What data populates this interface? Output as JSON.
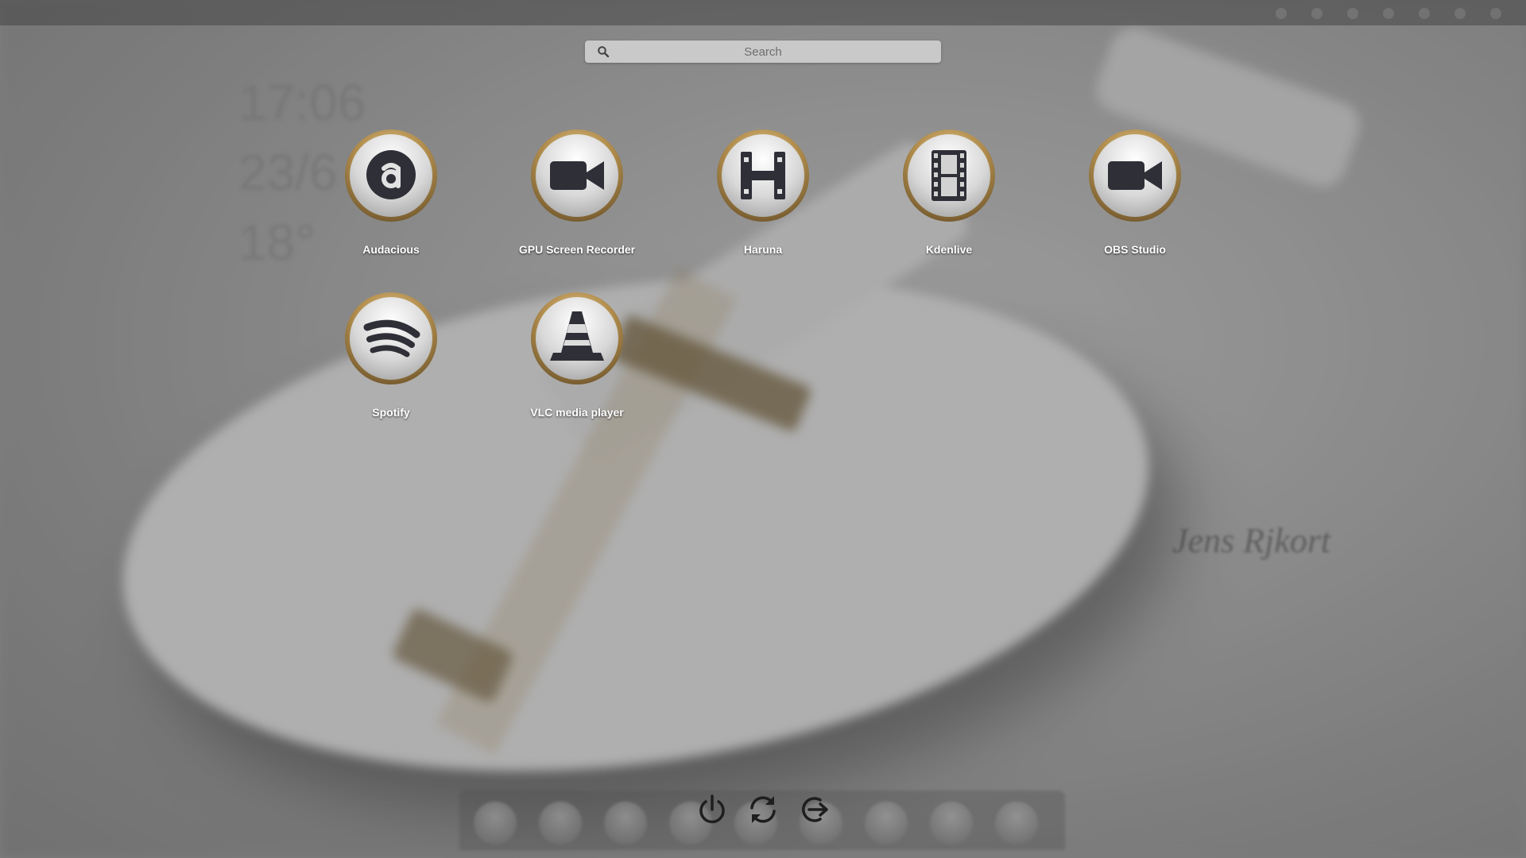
{
  "search": {
    "placeholder": "Search"
  },
  "desklet": {
    "time": "17:06",
    "date": "23/6",
    "temperature": "18°"
  },
  "wallpaper": {
    "signature": "Jens Rjkort"
  },
  "apps": [
    {
      "label": "Audacious",
      "icon": "audacious-icon"
    },
    {
      "label": "GPU Screen Recorder",
      "icon": "video-camera-icon"
    },
    {
      "label": "Haruna",
      "icon": "haruna-icon"
    },
    {
      "label": "Kdenlive",
      "icon": "film-strip-icon"
    },
    {
      "label": "OBS Studio",
      "icon": "video-camera-icon"
    },
    {
      "label": "Spotify",
      "icon": "spotify-icon"
    },
    {
      "label": "VLC media player",
      "icon": "vlc-cone-icon"
    }
  ],
  "session_buttons": [
    {
      "action": "Shut Down",
      "icon": "power-icon"
    },
    {
      "action": "Restart",
      "icon": "restart-icon"
    },
    {
      "action": "Log Out",
      "icon": "logout-icon"
    }
  ],
  "colors": {
    "icon_ring": "#b38f4f",
    "icon_face": "#d8d8d8",
    "glyph": "#2f2f38",
    "label": "#ffffff"
  }
}
